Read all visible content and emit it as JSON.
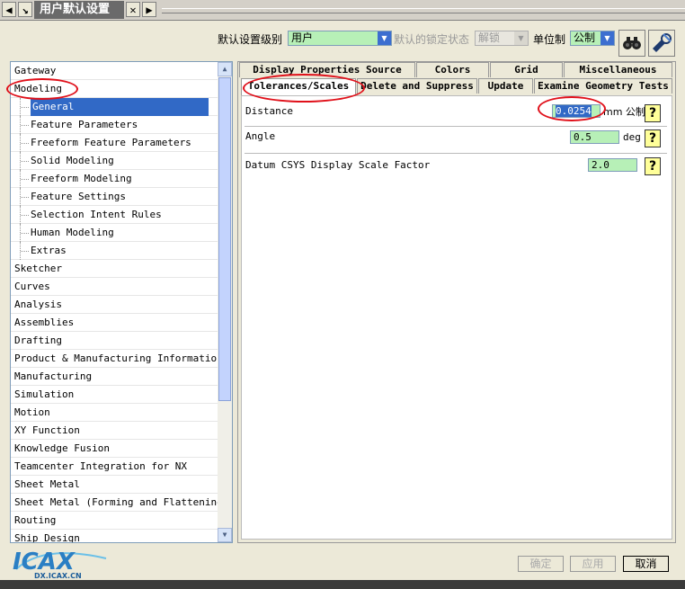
{
  "window": {
    "title": "用户默认设置"
  },
  "toolbar": {
    "level_label": "默认设置级别",
    "level_value": "用户",
    "lock_label": "默认的锁定状态",
    "lock_value": "解锁",
    "unit_label": "单位制",
    "unit_value": "公制"
  },
  "tree": {
    "items": [
      {
        "label": "Gateway",
        "child": false
      },
      {
        "label": "Modeling",
        "child": false
      },
      {
        "label": "General",
        "child": true,
        "selected": true
      },
      {
        "label": "Feature Parameters",
        "child": true
      },
      {
        "label": "Freeform Feature Parameters",
        "child": true
      },
      {
        "label": "Solid Modeling",
        "child": true
      },
      {
        "label": "Freeform Modeling",
        "child": true
      },
      {
        "label": "Feature Settings",
        "child": true
      },
      {
        "label": "Selection Intent Rules",
        "child": true
      },
      {
        "label": "Human Modeling",
        "child": true
      },
      {
        "label": "Extras",
        "child": true
      },
      {
        "label": "Sketcher",
        "child": false
      },
      {
        "label": "Curves",
        "child": false
      },
      {
        "label": "Analysis",
        "child": false
      },
      {
        "label": "Assemblies",
        "child": false
      },
      {
        "label": "Drafting",
        "child": false
      },
      {
        "label": "Product & Manufacturing Information",
        "child": false
      },
      {
        "label": "Manufacturing",
        "child": false
      },
      {
        "label": "Simulation",
        "child": false
      },
      {
        "label": "Motion",
        "child": false
      },
      {
        "label": "XY Function",
        "child": false
      },
      {
        "label": "Knowledge Fusion",
        "child": false
      },
      {
        "label": "Teamcenter Integration for NX",
        "child": false
      },
      {
        "label": "Sheet Metal",
        "child": false
      },
      {
        "label": "Sheet Metal (Forming and Flattening)",
        "child": false
      },
      {
        "label": "Routing",
        "child": false
      },
      {
        "label": "Ship Design",
        "child": false
      }
    ]
  },
  "tabs_row1": [
    "Display Properties Source",
    "Colors",
    "Grid",
    "Miscellaneous"
  ],
  "tabs_row2": [
    "Tolerances/Scales",
    "Delete and Suppress",
    "Update",
    "Examine Geometry Tests"
  ],
  "fields": {
    "distance": {
      "label": "Distance",
      "value": "0.0254",
      "unit": "mm 公制"
    },
    "angle": {
      "label": "Angle",
      "value": "0.5",
      "unit": "deg"
    },
    "datum": {
      "label": "Datum CSYS Display Scale Factor",
      "value": "2.0"
    }
  },
  "help_glyph": "?",
  "buttons": {
    "ok": "确定",
    "apply": "应用",
    "cancel": "取消"
  },
  "logo": {
    "text": "ICAX",
    "sub": "DX.ICAX.CN"
  },
  "colors": {
    "selection": "#3169c6",
    "input_bg": "#b7f0b7",
    "annotation": "#e0101a"
  }
}
